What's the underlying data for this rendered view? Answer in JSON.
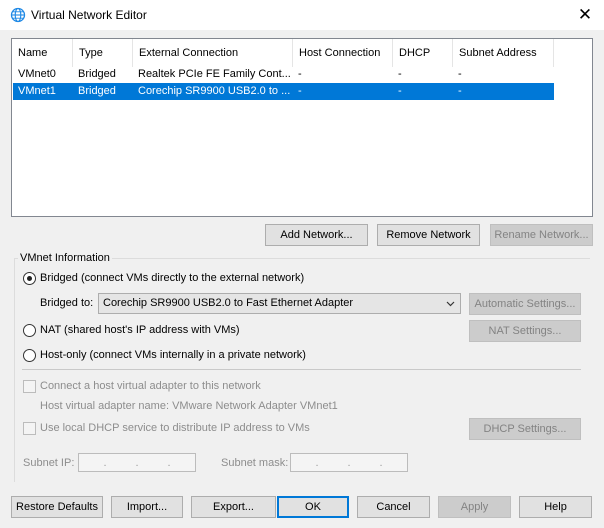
{
  "window": {
    "title": "Virtual Network Editor",
    "close_glyph": "✕"
  },
  "table": {
    "columns": [
      "Name",
      "Type",
      "External Connection",
      "Host Connection",
      "DHCP",
      "Subnet Address"
    ],
    "rows": [
      {
        "name": "VMnet0",
        "type": "Bridged",
        "external": "Realtek PCIe FE Family Cont...",
        "host": "-",
        "dhcp": "-",
        "subnet": "-",
        "selected": false
      },
      {
        "name": "VMnet1",
        "type": "Bridged",
        "external": "Corechip SR9900 USB2.0 to ...",
        "host": "-",
        "dhcp": "-",
        "subnet": "-",
        "selected": true
      }
    ]
  },
  "network_buttons": {
    "add": "Add Network...",
    "remove": "Remove Network",
    "rename": "Rename Network..."
  },
  "vmnet_info": {
    "group_label": "VMnet Information",
    "bridged_label": "Bridged (connect VMs directly to the external network)",
    "bridged_to_label": "Bridged to:",
    "bridged_to_value": "Corechip SR9900 USB2.0 to Fast Ethernet Adapter",
    "automatic_settings": "Automatic Settings...",
    "nat_label": "NAT (shared host's IP address with VMs)",
    "nat_settings": "NAT Settings...",
    "hostonly_label": "Host-only (connect VMs internally in a private network)",
    "connect_adapter_label": "Connect a host virtual adapter to this network",
    "adapter_name_label": "Host virtual adapter name: VMware Network Adapter VMnet1",
    "dhcp_label": "Use local DHCP service to distribute IP address to VMs",
    "dhcp_settings": "DHCP Settings...",
    "subnet_ip_label": "Subnet IP:",
    "subnet_mask_label": "Subnet mask:",
    "selected_mode": "bridged"
  },
  "footer": {
    "restore": "Restore Defaults",
    "import": "Import...",
    "export": "Export...",
    "ok": "OK",
    "cancel": "Cancel",
    "apply": "Apply",
    "help": "Help"
  },
  "colors": {
    "selection": "#0078d7",
    "window": "#f0f0f0",
    "accent_icon": "#1e88e5"
  },
  "icons": {
    "title": "globe-network-icon",
    "combo": "chevron-down-icon"
  }
}
